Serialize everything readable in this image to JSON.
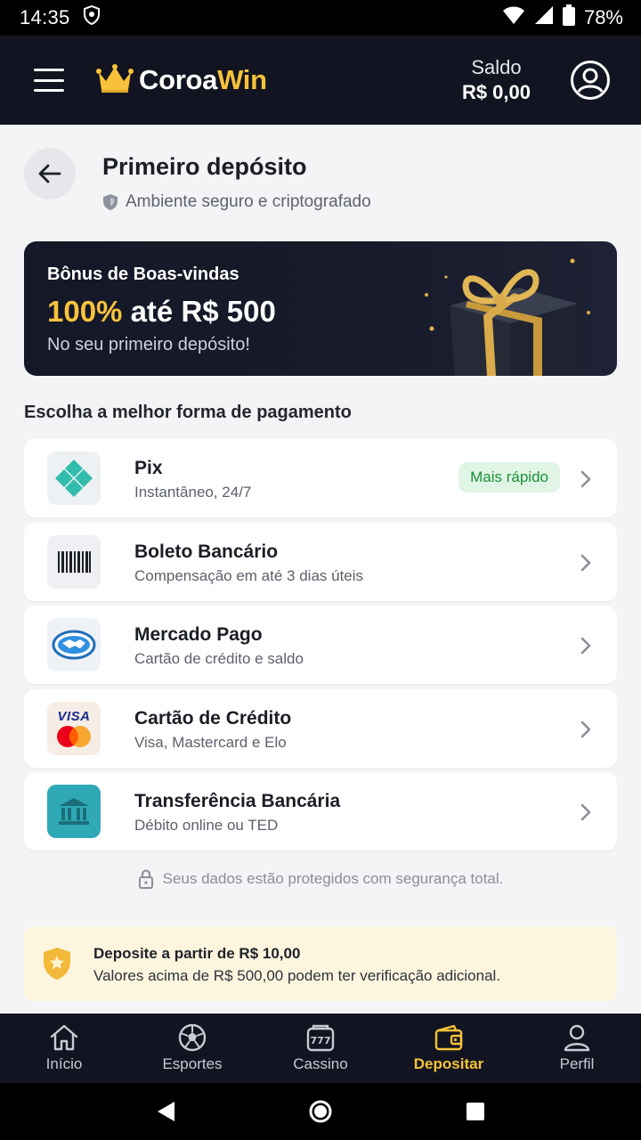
{
  "status_bar": {
    "time": "14:35",
    "battery": "78%"
  },
  "header": {
    "brand_part1": "Coroa",
    "brand_part2": "Win",
    "balance_label": "Saldo",
    "balance_value": "R$ 0,00"
  },
  "page": {
    "title": "Primeiro depósito",
    "subtitle": "Ambiente seguro e criptografado"
  },
  "bonus": {
    "heading": "Bônus de Boas-vindas",
    "percent": "100%",
    "amount": " até R$ 500",
    "caption": "No seu primeiro depósito!"
  },
  "payment": {
    "section_title": "Escolha a melhor forma de pagamento",
    "methods": [
      {
        "name": "Pix",
        "desc": "Instantâneo, 24/7",
        "badge": "Mais rápido",
        "icon": "pix-icon"
      },
      {
        "name": "Boleto Bancário",
        "desc": "Compensação em até 3 dias úteis",
        "icon": "barcode-icon"
      },
      {
        "name": "Mercado Pago",
        "desc": "Cartão de crédito e saldo",
        "icon": "handshake-icon"
      },
      {
        "name": "Cartão de Crédito",
        "desc": "Visa, Mastercard e Elo",
        "icon": "card-brands-icon",
        "visa_label": "VISA"
      },
      {
        "name": "Transferência Bancária",
        "desc": "Débito online ou TED",
        "icon": "bank-icon"
      }
    ]
  },
  "security_note": "Seus dados estão protegidos com segurança total.",
  "info_box": {
    "title": "Deposite a partir de R$ 10,00",
    "text": "Valores acima de R$ 500,00 podem ter verificação adicional."
  },
  "bottom_nav": [
    {
      "label": "Início",
      "icon": "home-icon"
    },
    {
      "label": "Esportes",
      "icon": "soccer-ball-icon"
    },
    {
      "label": "Cassino",
      "icon": "slot-machine-icon"
    },
    {
      "label": "Depositar",
      "icon": "wallet-icon",
      "active": true
    },
    {
      "label": "Perfil",
      "icon": "user-icon"
    }
  ],
  "colors": {
    "accent": "#f7c23a",
    "header_bg": "#121521",
    "pix": "#32bcad",
    "success": "#1a8f3a"
  }
}
